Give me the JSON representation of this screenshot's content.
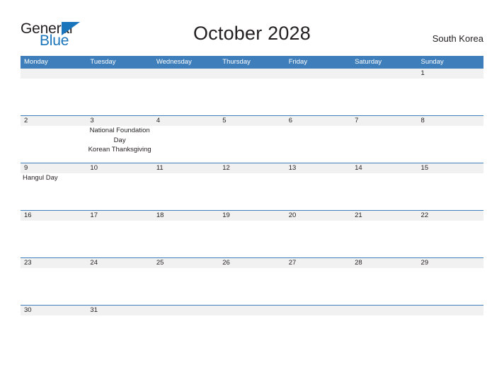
{
  "brand": {
    "name_part1": "General",
    "name_part2": "Blue"
  },
  "header": {
    "title": "October 2028",
    "country": "South Korea"
  },
  "calendar": {
    "weekdays": [
      "Monday",
      "Tuesday",
      "Wednesday",
      "Thursday",
      "Friday",
      "Saturday",
      "Sunday"
    ],
    "accent_color": "#3d7ebb",
    "band_color": "#f1f1f1",
    "weeks": [
      {
        "band_width_percent": 100,
        "days": [
          {
            "date": "",
            "events": []
          },
          {
            "date": "",
            "events": []
          },
          {
            "date": "",
            "events": []
          },
          {
            "date": "",
            "events": []
          },
          {
            "date": "",
            "events": []
          },
          {
            "date": "",
            "events": []
          },
          {
            "date": "1",
            "events": []
          }
        ]
      },
      {
        "band_width_percent": 100,
        "days": [
          {
            "date": "2",
            "events": []
          },
          {
            "date": "3",
            "events": [
              "National Foundation Day",
              "Korean Thanksgiving"
            ]
          },
          {
            "date": "4",
            "events": []
          },
          {
            "date": "5",
            "events": []
          },
          {
            "date": "6",
            "events": []
          },
          {
            "date": "7",
            "events": []
          },
          {
            "date": "8",
            "events": []
          }
        ]
      },
      {
        "band_width_percent": 100,
        "days": [
          {
            "date": "9",
            "events": [
              "Hangul Day"
            ],
            "align": "left"
          },
          {
            "date": "10",
            "events": []
          },
          {
            "date": "11",
            "events": []
          },
          {
            "date": "12",
            "events": []
          },
          {
            "date": "13",
            "events": []
          },
          {
            "date": "14",
            "events": []
          },
          {
            "date": "15",
            "events": []
          }
        ]
      },
      {
        "band_width_percent": 100,
        "days": [
          {
            "date": "16",
            "events": []
          },
          {
            "date": "17",
            "events": []
          },
          {
            "date": "18",
            "events": []
          },
          {
            "date": "19",
            "events": []
          },
          {
            "date": "20",
            "events": []
          },
          {
            "date": "21",
            "events": []
          },
          {
            "date": "22",
            "events": []
          }
        ]
      },
      {
        "band_width_percent": 100,
        "days": [
          {
            "date": "23",
            "events": []
          },
          {
            "date": "24",
            "events": []
          },
          {
            "date": "25",
            "events": []
          },
          {
            "date": "26",
            "events": []
          },
          {
            "date": "27",
            "events": []
          },
          {
            "date": "28",
            "events": []
          },
          {
            "date": "29",
            "events": []
          }
        ]
      },
      {
        "short": true,
        "band_width_percent": 100,
        "days": [
          {
            "date": "30",
            "events": []
          },
          {
            "date": "31",
            "events": []
          },
          {
            "date": "",
            "events": []
          },
          {
            "date": "",
            "events": []
          },
          {
            "date": "",
            "events": []
          },
          {
            "date": "",
            "events": []
          },
          {
            "date": "",
            "events": []
          }
        ]
      }
    ]
  }
}
